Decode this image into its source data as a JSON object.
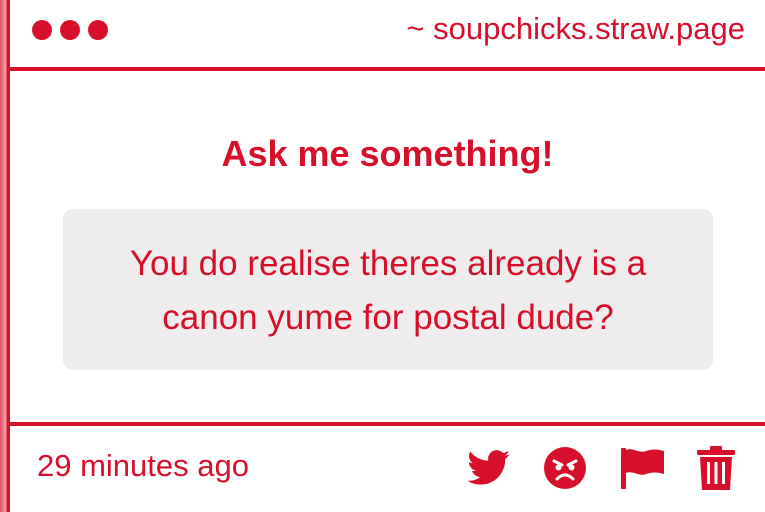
{
  "titlebar": {
    "dots": [
      "dot",
      "dot",
      "dot"
    ],
    "url": "~ soupchicks.straw.page"
  },
  "main": {
    "heading": "Ask me something!",
    "question": "You do realise theres already is a canon yume for postal dude?"
  },
  "footer": {
    "timestamp": "29 minutes ago",
    "actions": [
      {
        "name": "twitter-share",
        "icon": "twitter-bird-icon"
      },
      {
        "name": "react-angry",
        "icon": "angry-face-icon"
      },
      {
        "name": "report",
        "icon": "flag-icon"
      },
      {
        "name": "delete",
        "icon": "trash-icon"
      }
    ]
  },
  "colors": {
    "accent": "#d70f2a",
    "question_bg": "#eeeced",
    "background": "#ffffff"
  }
}
